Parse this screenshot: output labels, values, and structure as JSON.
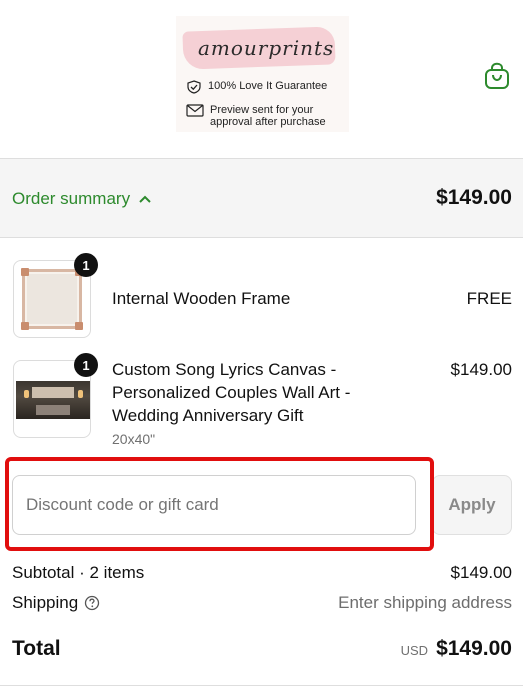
{
  "header": {
    "brand": "amourprints",
    "guarantee": "100% Love It Guarantee",
    "preview_line1": "Preview sent for your",
    "preview_line2": "approval after purchase"
  },
  "summary": {
    "toggle_label": "Order summary",
    "total": "$149.00"
  },
  "items": [
    {
      "qty": "1",
      "title": "Internal Wooden Frame",
      "variant": "",
      "price": "FREE"
    },
    {
      "qty": "1",
      "title": "Custom Song Lyrics Canvas - Personalized Couples Wall Art - Wedding Anniversary Gift",
      "variant": "20x40\"",
      "price": "$149.00"
    }
  ],
  "discount": {
    "placeholder": "Discount code or gift card",
    "value": "",
    "apply_label": "Apply"
  },
  "totals": {
    "subtotal_label": "Subtotal · 2 items",
    "subtotal_value": "$149.00",
    "shipping_label": "Shipping",
    "shipping_value": "Enter shipping address",
    "total_label": "Total",
    "currency": "USD",
    "total_value": "$149.00"
  },
  "colors": {
    "accent_green": "#2d8a2d",
    "highlight_red": "#e10e0e"
  },
  "icons": [
    "check-shield-icon",
    "envelope-icon",
    "shopping-bag-icon",
    "chevron-up-icon",
    "help-circle-icon"
  ]
}
